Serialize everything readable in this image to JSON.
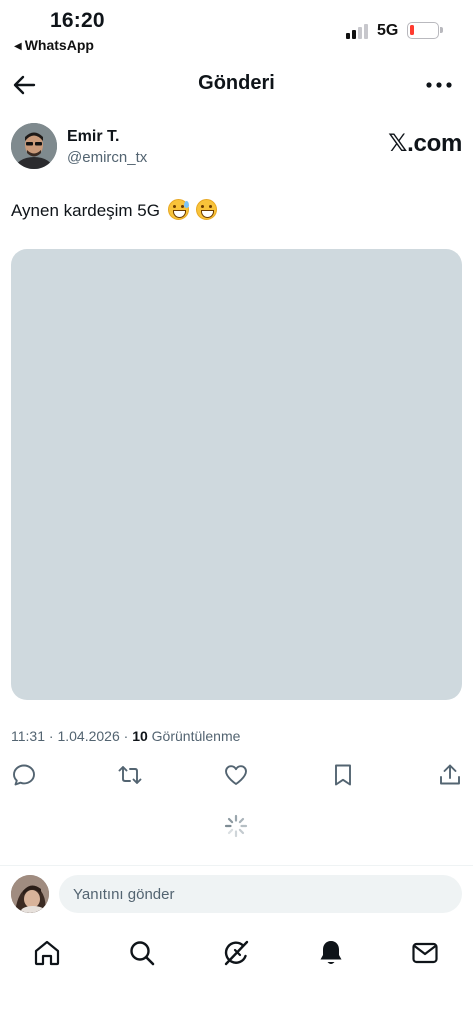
{
  "status_bar": {
    "time": "16:20",
    "back_app": "WhatsApp",
    "back_arrow_glyph": "◀",
    "network": "5G",
    "battery_color": "#ff3b30"
  },
  "header": {
    "title": "Gönderi",
    "back_icon": "arrow-left-icon",
    "more_icon": "more-dots-icon"
  },
  "post": {
    "author_name": "Emir T.",
    "author_handle": "@emircn_tx",
    "source_logo": "𝕏.com",
    "text": "Aynen kardeşim 5G",
    "emojis": [
      "grinning-face-with-sweat",
      "beaming-face-with-smiling-eyes"
    ],
    "time": "11:31",
    "date": "1.04.2026",
    "separator": "·",
    "views_count": "10",
    "views_label": "Görüntülenme",
    "media_placeholder_color": "#cfd9de"
  },
  "actions": {
    "icons": [
      "reply-icon",
      "retweet-icon",
      "like-icon",
      "bookmark-icon",
      "share-icon"
    ]
  },
  "reply": {
    "placeholder": "Yanıtını gönder"
  },
  "tab_bar": {
    "icons": [
      "home-icon",
      "search-icon",
      "grok-icon",
      "notifications-icon",
      "messages-icon"
    ]
  },
  "colors": {
    "text_primary": "#0f1419",
    "text_secondary": "#536471",
    "divider": "#eff3f4"
  }
}
